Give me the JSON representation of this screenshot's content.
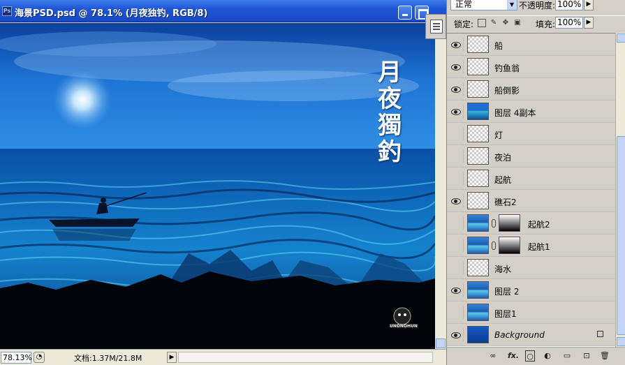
{
  "document": {
    "title": "海景PSD.psd @ 78.1% (月夜独钓, RGB/8)",
    "artwork_title": "月夜獨釣",
    "watermark": "UNDNOHUN",
    "zoom": "78.13%",
    "doc_info": "文档:1.37M/21.8M"
  },
  "layers_panel": {
    "blend_mode": "正常",
    "opacity_label": "不透明度:",
    "opacity_value": "100%",
    "lock_label": "锁定:",
    "fill_label": "填充:",
    "fill_value": "100%",
    "layers": [
      {
        "name": "船",
        "visible": true
      },
      {
        "name": "钓鱼翁",
        "visible": true
      },
      {
        "name": "船倒影",
        "visible": true
      },
      {
        "name": "图层 4副本",
        "visible": true
      },
      {
        "name": "灯",
        "visible": false
      },
      {
        "name": "夜泊",
        "visible": false
      },
      {
        "name": "起航",
        "visible": false
      },
      {
        "name": "礁石2",
        "visible": true
      },
      {
        "name": "起航2",
        "visible": false
      },
      {
        "name": "起航1",
        "visible": false
      },
      {
        "name": "海水",
        "visible": false
      },
      {
        "name": "图层 2",
        "visible": true
      },
      {
        "name": "图层1",
        "visible": false
      },
      {
        "name": "Background",
        "visible": true
      }
    ]
  },
  "icons": {
    "link": "link-icon",
    "fx": "fx-icon",
    "mask": "mask-icon",
    "adjust": "adjustment-icon",
    "folder": "folder-icon",
    "new": "new-layer-icon",
    "trash": "trash-icon"
  },
  "bottom_bar": {
    "fx_label": "fx."
  }
}
